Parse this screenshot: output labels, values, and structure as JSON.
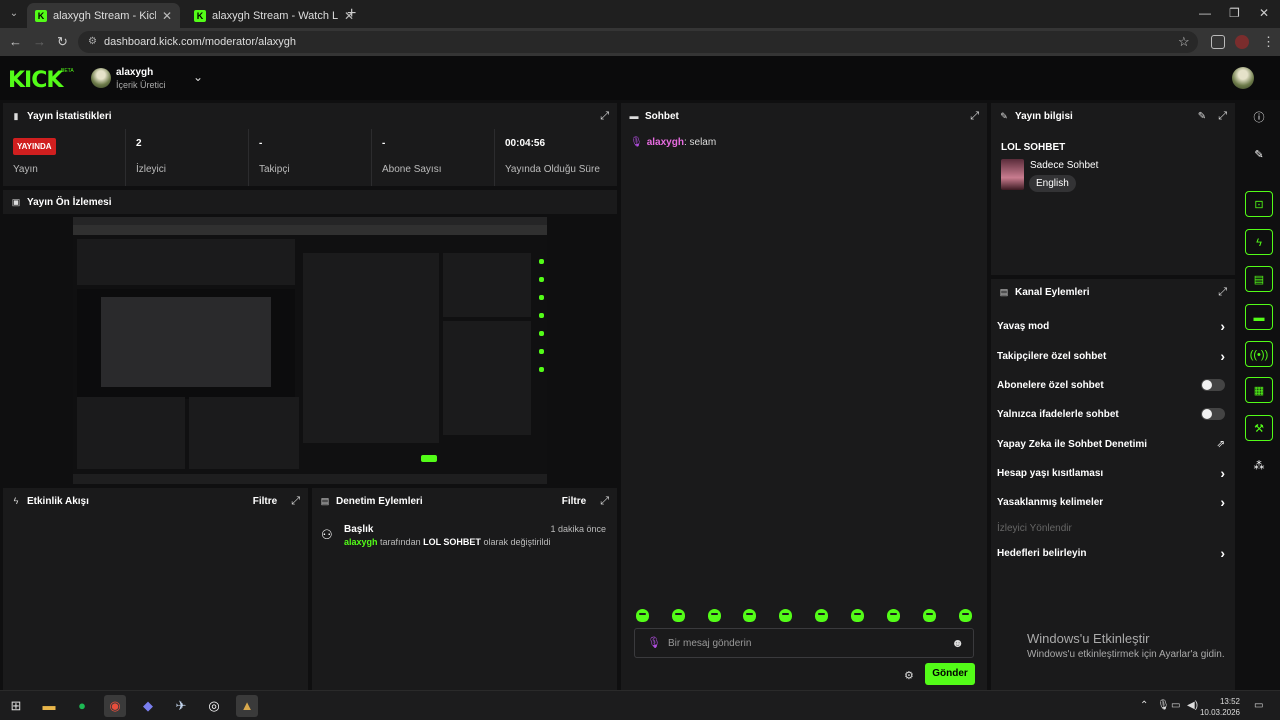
{
  "browser": {
    "tabs": [
      {
        "title": "alaxygh Stream - Kick Dashboar",
        "active": true
      },
      {
        "title": "alaxygh Stream - Watch Live on",
        "active": false
      }
    ],
    "url": "dashboard.kick.com/moderator/alaxygh"
  },
  "header": {
    "logo": "KICK",
    "beta": "BETA",
    "channel_name": "alaxygh",
    "channel_role": "İçerik Üretici"
  },
  "stats": {
    "title": "Yayın İstatistikleri",
    "live_badge": "YAYINDA",
    "items": [
      {
        "value": "",
        "label": "Yayın"
      },
      {
        "value": "2",
        "label": "İzleyici"
      },
      {
        "value": "-",
        "label": "Takipçi"
      },
      {
        "value": "-",
        "label": "Abone Sayısı"
      },
      {
        "value": "00:04:56",
        "label": "Yayında Olduğu Süre"
      }
    ]
  },
  "preview": {
    "title": "Yayın Ön İzlemesi"
  },
  "activity": {
    "title": "Etkinlik Akışı",
    "filter": "Filtre"
  },
  "audit": {
    "title": "Denetim Eylemleri",
    "filter": "Filtre",
    "entry": {
      "title": "Başlık",
      "time": "1 dakika önce",
      "user": "alaxygh",
      "mid": "tarafından",
      "value": "LOL SOHBET",
      "tail": "olarak değiştirildi"
    }
  },
  "chat": {
    "title": "Sohbet",
    "messages": [
      {
        "user": "alaxygh",
        "text": ": selam"
      }
    ],
    "placeholder": "Bir mesaj gönderin",
    "send": "Gönder"
  },
  "stream_info": {
    "title": "Yayın bilgisi",
    "stream_title": "LOL SOHBET",
    "category": "Sadece Sohbet",
    "language": "English"
  },
  "channel_actions": {
    "title": "Kanal Eylemleri",
    "items": [
      {
        "label": "Yavaş mod",
        "control": "chevron"
      },
      {
        "label": "Takipçilere özel sohbet",
        "control": "chevron"
      },
      {
        "label": "Abonelere özel sohbet",
        "control": "toggle"
      },
      {
        "label": "Yalnızca ifadelerle sohbet",
        "control": "toggle"
      },
      {
        "label": "Yapay Zeka ile Sohbet Denetimi",
        "control": "external"
      },
      {
        "label": "Hesap yaşı kısıtlaması",
        "control": "chevron"
      },
      {
        "label": "Yasaklanmış kelimeler",
        "control": "chevron"
      },
      {
        "label": "İzleyici Yönlendir",
        "control": "none"
      },
      {
        "label": "Hedefleri belirleyin",
        "control": "chevron"
      }
    ]
  },
  "watermark": {
    "line1": "Windows'u Etkinleştir",
    "line2": "Windows'u etkinleştirmek için Ayarlar'a gidin."
  },
  "clock": {
    "time": "13:52",
    "date": "10.03.2026"
  },
  "colors": {
    "accent": "#53fc18",
    "live": "#d01f1f",
    "username": "#e76ce0"
  }
}
